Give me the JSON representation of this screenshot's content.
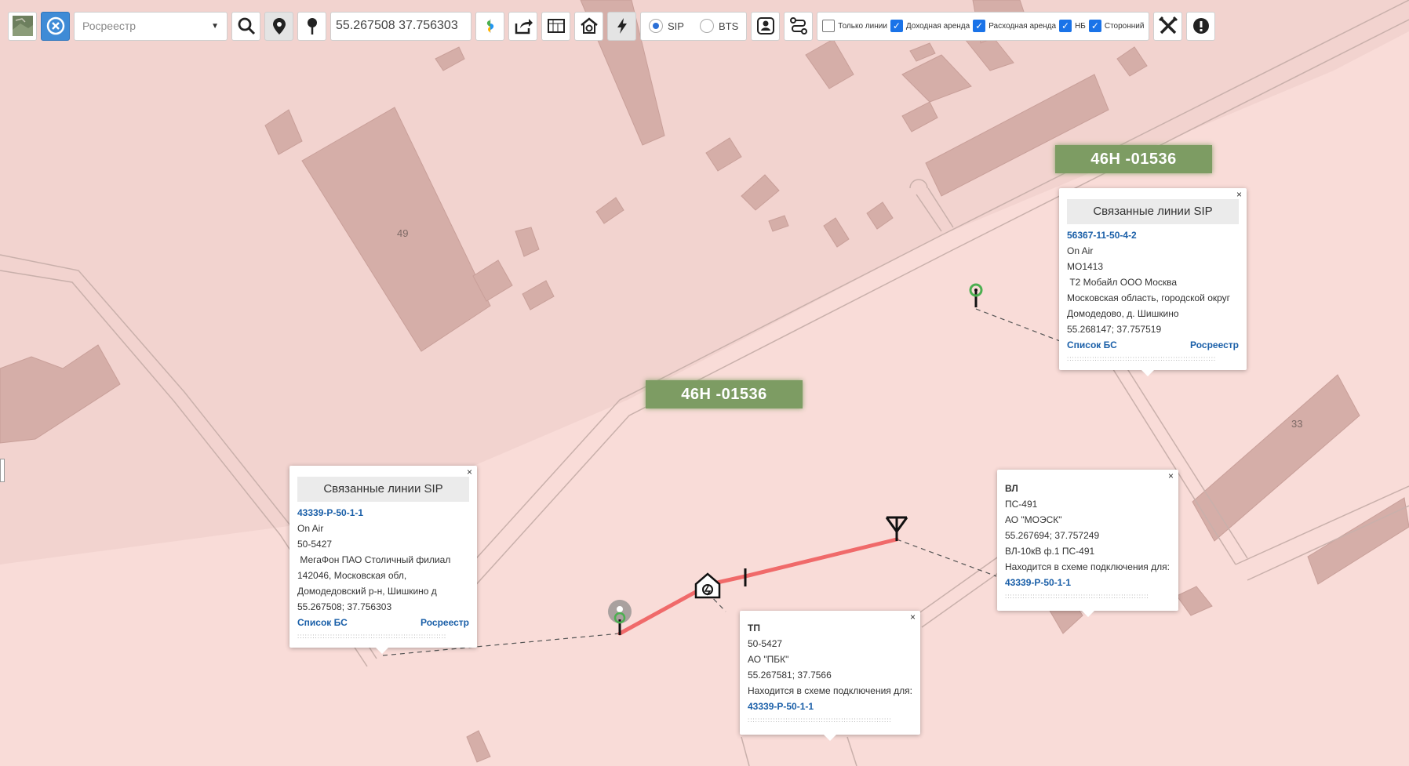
{
  "toolbar": {
    "layer_select": "Росреестр",
    "coords_value": "55.267508 37.756303",
    "radio_sip": "SIP",
    "radio_bts": "BTS",
    "check_only_lines": "Только линии",
    "check_income": "Доходная аренда",
    "check_expense": "Расходная аренда",
    "check_nb": "НБ",
    "check_third": "Сторонний"
  },
  "map": {
    "road_label_1": "46Н -01536",
    "road_label_2": "46Н -01536",
    "building_49": "49",
    "building_33": "33"
  },
  "popup_sip_right": {
    "close": "×",
    "header": "Связанные линии SIP",
    "id": "56367-11-50-4-2",
    "status": "On Air",
    "code": "МО1413",
    "operator": " Т2 Мобайл ООО Москва",
    "address1": "Московская область, городской округ",
    "address2": "Домодедово, д. Шишкино",
    "coords": "55.268147; 37.757519",
    "link_bs": "Список БС",
    "link_rosreestr": "Росреестр"
  },
  "popup_sip_left": {
    "close": "×",
    "header": "Связанные линии SIP",
    "id": "43339-Р-50-1-1",
    "status": "On Air",
    "code": "50-5427",
    "operator": " МегаФон ПАО Столичный филиал",
    "address1": "142046, Московская обл,",
    "address2": "Домодедовский р-н, Шишкино д",
    "coords": "55.267508; 37.756303",
    "link_bs": "Список БС",
    "link_rosreestr": "Росреестр"
  },
  "popup_vl": {
    "close": "×",
    "title": "ВЛ",
    "line1": "ПС-491",
    "line2": "АО \"МОЭСК\"",
    "line3": "55.267694; 37.757249",
    "line4": "ВЛ-10кВ ф.1 ПС-491",
    "line5": "Находится в схеме подключения для:",
    "link": "43339-Р-50-1-1"
  },
  "popup_tp": {
    "close": "×",
    "title": "ТП",
    "line1": "50-5427",
    "line2": "АО \"ПБК\"",
    "line3": "55.267581; 37.7566",
    "line4": "Находится в схеме подключения для:",
    "link": "43339-Р-50-1-1"
  },
  "colors": {
    "map_bg": "#f9dcd8",
    "building": "#d5aea8",
    "road_label": "#7d9c63",
    "power_line": "#f06a6a",
    "link": "#1a5fa8"
  }
}
